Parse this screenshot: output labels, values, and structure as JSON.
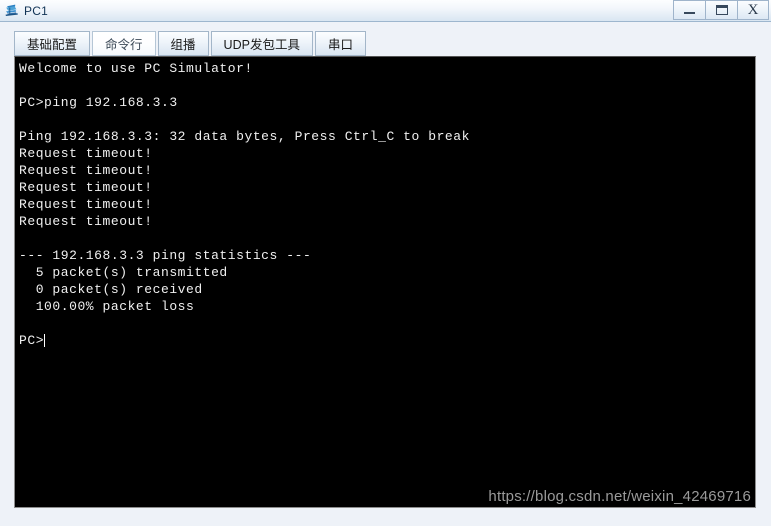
{
  "window": {
    "title": "PC1",
    "icon": "pc-device-icon",
    "controls": [
      {
        "name": "minimize-button",
        "label": "–",
        "glyph": "minimize"
      },
      {
        "name": "maximize-button",
        "label": "□",
        "glyph": "maximize"
      },
      {
        "name": "close-button",
        "label": "X",
        "glyph": "close"
      }
    ]
  },
  "tabs": [
    {
      "id": "basic-config",
      "label": "基础配置",
      "active": false
    },
    {
      "id": "command-line",
      "label": "命令行",
      "active": true
    },
    {
      "id": "multicast",
      "label": "组播",
      "active": false
    },
    {
      "id": "udp-packet-tool",
      "label": "UDP发包工具",
      "active": false
    },
    {
      "id": "serial-port",
      "label": "串口",
      "active": false
    }
  ],
  "terminal": {
    "lines": [
      "Welcome to use PC Simulator!",
      "",
      "PC>ping 192.168.3.3",
      "",
      "Ping 192.168.3.3: 32 data bytes, Press Ctrl_C to break",
      "Request timeout!",
      "Request timeout!",
      "Request timeout!",
      "Request timeout!",
      "Request timeout!",
      "",
      "--- 192.168.3.3 ping statistics ---",
      "  5 packet(s) transmitted",
      "  0 packet(s) received",
      "  100.00% packet loss",
      ""
    ],
    "prompt": "PC>",
    "input_value": "",
    "colors": {
      "background": "#000000",
      "foreground": "#f0f0f0"
    }
  },
  "watermark": {
    "text": "https://blog.csdn.net/weixin_42469716"
  }
}
